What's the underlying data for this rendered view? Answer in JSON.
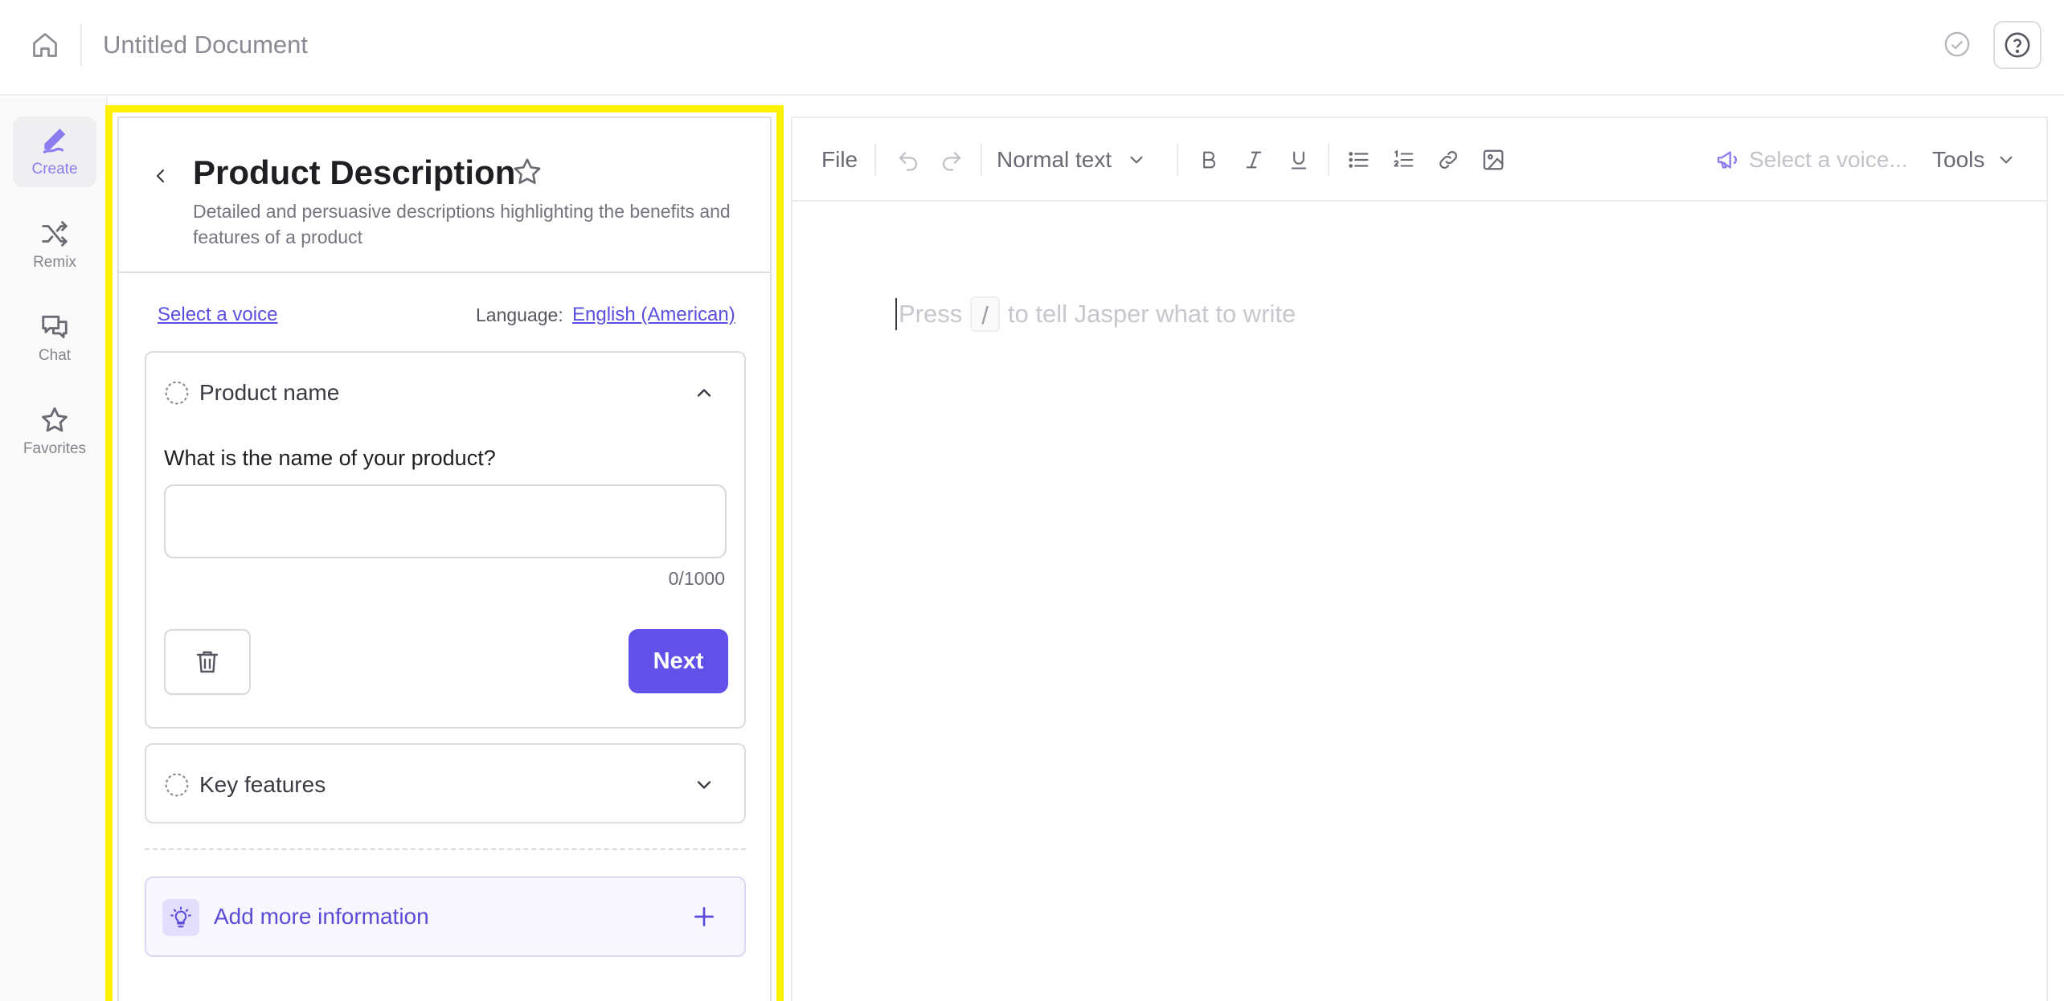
{
  "topbar": {
    "document_title": "Untitled Document"
  },
  "rail": {
    "items": [
      {
        "label": "Create",
        "icon": "pen-icon",
        "active": true
      },
      {
        "label": "Remix",
        "icon": "shuffle-icon",
        "active": false
      },
      {
        "label": "Chat",
        "icon": "chat-icon",
        "active": false
      },
      {
        "label": "Favorites",
        "icon": "star-icon",
        "active": false
      }
    ]
  },
  "panel": {
    "title": "Product Description",
    "subtitle": "Detailed and persuasive descriptions highlighting the benefits and features of a product",
    "voice_link": "Select a voice",
    "language_label": "Language:",
    "language_value": "English (American)",
    "steps": [
      {
        "label": "Product name",
        "expanded": true,
        "question": "What is the name of your product?",
        "input_value": "",
        "counter": "0/1000"
      },
      {
        "label": "Key features",
        "expanded": false
      }
    ],
    "next_label": "Next",
    "add_info_label": "Add more information"
  },
  "editor": {
    "toolbar": {
      "file_label": "File",
      "text_style": "Normal text",
      "voice_placeholder": "Select a voice...",
      "tools_label": "Tools"
    },
    "placeholder_before": "Press",
    "placeholder_key": "/",
    "placeholder_after": "to tell Jasper what to write"
  },
  "colors": {
    "accent": "#6151e8",
    "link": "#5b4fe0",
    "highlight": "#fff200"
  }
}
